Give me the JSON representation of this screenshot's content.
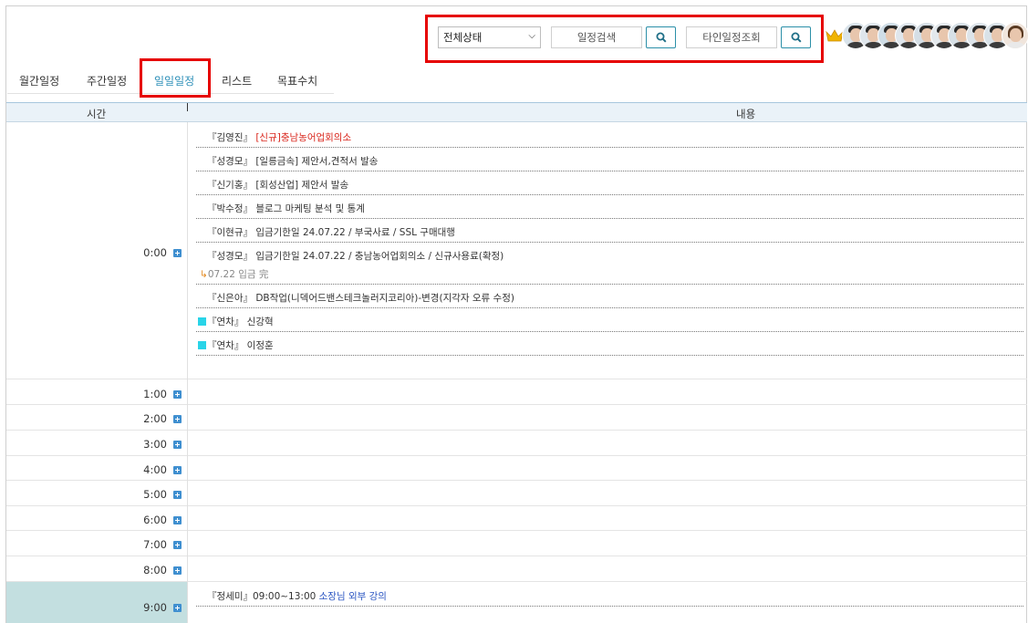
{
  "filters": {
    "status_select": "전체상태",
    "search_input": "일정검색",
    "other_input": "타인일정조회"
  },
  "tabs": [
    "월간일정",
    "주간일정",
    "일일일정",
    "리스트",
    "목표수치"
  ],
  "active_tab": 2,
  "table": {
    "header_time": "시간",
    "header_content": "내용"
  },
  "hours": [
    "0:00",
    "1:00",
    "2:00",
    "3:00",
    "4:00",
    "5:00",
    "6:00",
    "7:00",
    "8:00",
    "9:00"
  ],
  "events_0": [
    {
      "name": "『김영진』",
      "rest": " [신규]충남농어업회의소",
      "style": "red"
    },
    {
      "name": "『성경모』",
      "rest": " [일릉금속] 제안서,견적서 발송",
      "style": "normal"
    },
    {
      "name": "『신기홍』",
      "rest": " [회성산업] 제안서 발송",
      "style": "normal"
    },
    {
      "name": "『박수정』",
      "rest": " 블로그 마케팅 분석 및 통계",
      "style": "normal"
    },
    {
      "name": "『이현규』",
      "rest": " 입금기한일 24.07.22 / 부국사료 / SSL 구매대행",
      "style": "normal"
    },
    {
      "name": "『성경모』",
      "rest": " 입금기한일 24.07.22 / 충남농어업회의소 / 신규사용료(확정)",
      "style": "normal",
      "sub_arrow": "↳",
      "sub": "07.22 입금 完"
    },
    {
      "name": "『신은아』",
      "rest": " DB작업(니덱어드밴스테크놀러지코리아)-변경(지각자 오류 수정)",
      "style": "normal"
    },
    {
      "name": "『연차』",
      "rest": " 신강혁",
      "style": "square"
    },
    {
      "name": "『연차』",
      "rest": " 이정훈",
      "style": "square"
    }
  ],
  "events_9": [
    {
      "name": "『정세미』",
      "prefix": "09:00~13:00 ",
      "rest": "소장님 외부 강의",
      "style": "blue"
    }
  ],
  "colors": {
    "accent": "#2d8fb8",
    "highlight_box": "#e60000",
    "leave_marker": "#29d4e8",
    "current_hour_bg": "#c3dfe0"
  },
  "icons": [
    "search-icon",
    "crown-icon",
    "plus-icon",
    "chevron-down-icon",
    "avatar"
  ]
}
